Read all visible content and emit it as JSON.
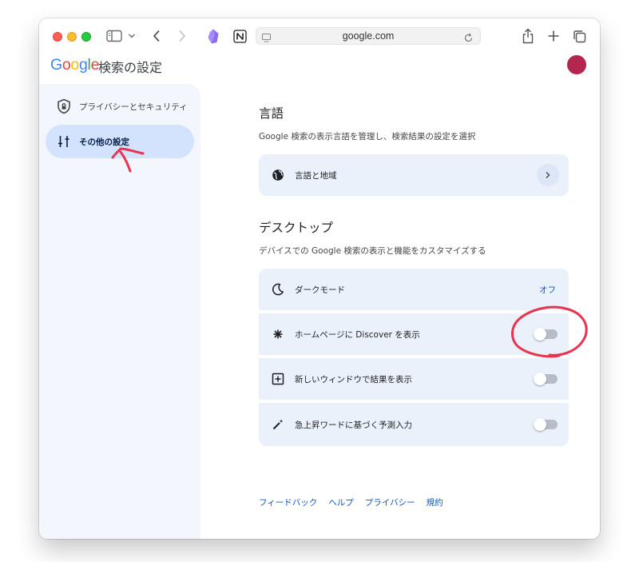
{
  "browser": {
    "url": "google.com"
  },
  "header": {
    "logo_letters": [
      {
        "char": "G",
        "color": "#4285f4"
      },
      {
        "char": "o",
        "color": "#ea4335"
      },
      {
        "char": "o",
        "color": "#fbbc05"
      },
      {
        "char": "g",
        "color": "#4285f4"
      },
      {
        "char": "l",
        "color": "#34a853"
      },
      {
        "char": "e",
        "color": "#ea4335"
      }
    ],
    "title": "検索の設定",
    "avatar_color": "#b3264f"
  },
  "sidebar": {
    "items": [
      {
        "label": "プライバシーとセキュリティ",
        "icon": "shield-lock-icon",
        "selected": false
      },
      {
        "label": "その他の設定",
        "icon": "tune-sliders-icon",
        "selected": true
      }
    ]
  },
  "language_section": {
    "title": "言語",
    "description": "Google 検索の表示言語を管理し、検索結果の設定を選択",
    "row": {
      "label": "言語と地域",
      "icon": "globe-icon",
      "action_icon": "chevron-right-icon"
    }
  },
  "desktop_section": {
    "title": "デスクトップ",
    "description": "デバイスでの Google 検索の表示と機能をカスタマイズする",
    "rows": [
      {
        "label": "ダークモード",
        "icon": "moon-icon",
        "value": "オフ"
      },
      {
        "label": "ホームページに Discover を表示",
        "icon": "asterisk-icon",
        "toggle": false
      },
      {
        "label": "新しいウィンドウで結果を表示",
        "icon": "open-new-window-icon",
        "toggle": false
      },
      {
        "label": "急上昇ワードに基づく予測入力",
        "icon": "magic-wand-icon",
        "toggle": false
      }
    ]
  },
  "footer": {
    "links": [
      "フィードバック",
      "ヘルプ",
      "プライバシー",
      "規約"
    ]
  },
  "colors": {
    "accent": "#0b57d0",
    "card_bg": "#eaf1fb",
    "sidebar_bg": "#f3f6fc",
    "sidebar_selected": "#d3e3fd",
    "annotation": "#e8344e"
  }
}
